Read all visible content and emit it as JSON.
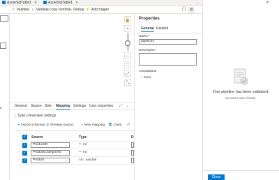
{
  "tabs": [
    {
      "label": "AzureSqlTable1"
    },
    {
      "label": "AzureSqlTable1"
    }
  ],
  "toolbar": {
    "validate": "Validate",
    "validate_copy_runtime": "Validate copy runtime",
    "debug": "Debug",
    "add_trigger": "Add trigger"
  },
  "bottom_tabs": [
    "General",
    "Source",
    "Sink",
    "Mapping",
    "Settings",
    "User properties"
  ],
  "bottom_active_tab": "Mapping",
  "mapping": {
    "type_conversion_settings": "Type conversion settings",
    "import_schemas": "Import schemas",
    "preview_source": "Preview source",
    "new_mapping": "New mapping",
    "clear": "Clear",
    "columns": {
      "source": "Source",
      "type": "Type",
      "dest": "D"
    },
    "rows": [
      {
        "source": "ProductID",
        "type": "int"
      },
      {
        "source": "ProductCategoryID",
        "type": "int"
      },
      {
        "source": "Product",
        "type": "varchar"
      }
    ]
  },
  "properties": {
    "title": "Properties",
    "tabs": [
      "General",
      "Related"
    ],
    "name_label": "Name *",
    "name_value": "pipeline1",
    "description_label": "Description",
    "annotations_label": "Annotations",
    "new_label": "New"
  },
  "validation": {
    "title": "Your pipeline has been validated.",
    "subtitle": "No errors were found.",
    "close_label": "Close"
  },
  "colors": {
    "accent": "#0078d4",
    "border": "#e1dfdd"
  }
}
